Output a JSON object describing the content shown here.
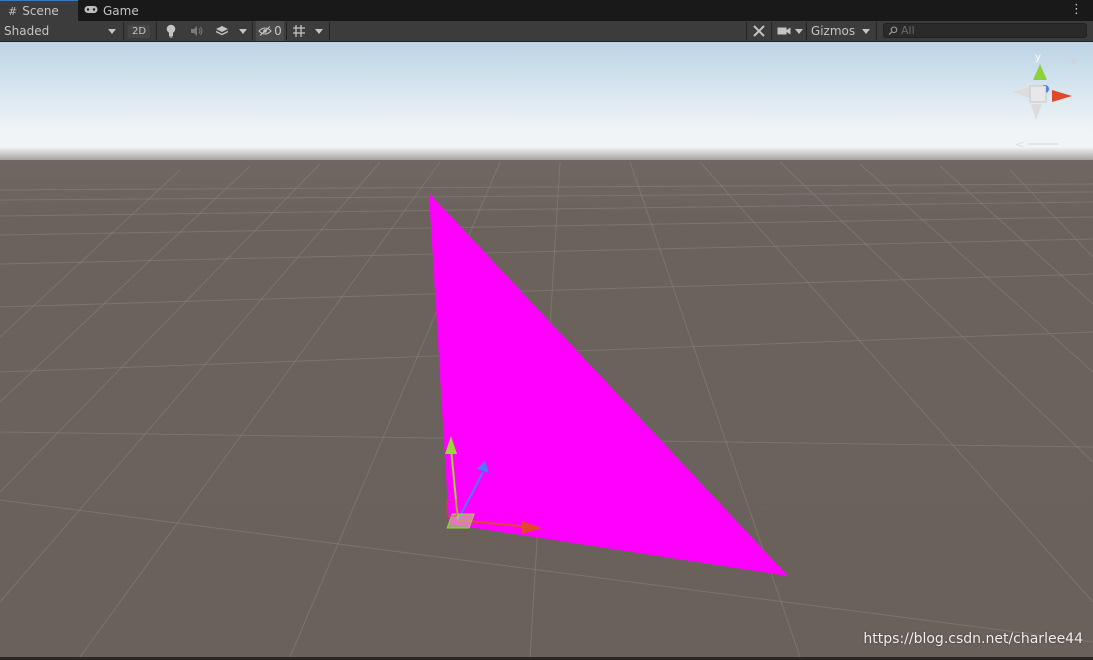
{
  "tabs": [
    {
      "label": "Scene",
      "icon": "hash-icon",
      "active": true
    },
    {
      "label": "Game",
      "icon": "gamepad-icon",
      "active": false
    }
  ],
  "toolbar": {
    "shading_mode": "Shaded",
    "mode_2d": "2D",
    "hidden_count": "0",
    "gizmos_label": "Gizmos",
    "search_placeholder": "All"
  },
  "scene": {
    "colors": {
      "sky_top": "#bcd4e6",
      "horizon": "#f2f6f8",
      "ground": "#6b625c",
      "triangle": "#ff00ff"
    },
    "orientation_gizmo": {
      "axis_label": "y"
    }
  },
  "watermark": "https://blog.csdn.net/charlee44"
}
